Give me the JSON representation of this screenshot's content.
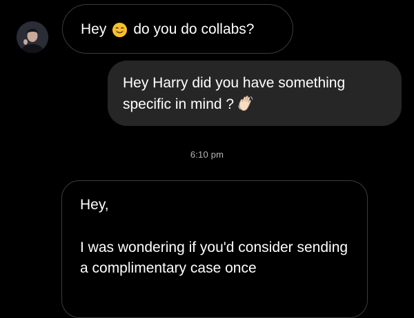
{
  "conversation": {
    "messages": [
      {
        "sender": "other",
        "before_emoji": "Hey",
        "emoji": "smiling-face",
        "after_emoji": "do you do collabs?"
      },
      {
        "sender": "me",
        "text": "Hey Harry did you have something specific in mind ?",
        "emoji": "waving-hand"
      },
      {
        "sender": "other",
        "greeting": "Hey,",
        "body": "I was wondering if you'd consider sending a complimentary case once"
      }
    ],
    "timestamp": "6:10 pm"
  },
  "colors": {
    "background": "#000000",
    "sent_bubble": "#262626",
    "received_border": "#3c3c3c",
    "timestamp_text": "#b9b9b9"
  }
}
